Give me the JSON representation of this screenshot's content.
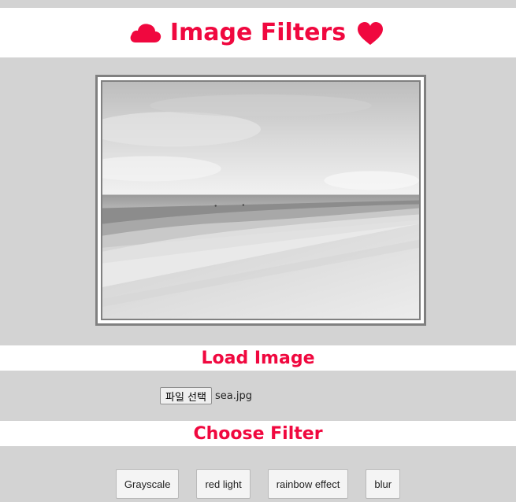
{
  "header": {
    "title": "Image Filters",
    "left_icon": "cloud-icon",
    "right_icon": "heart-icon",
    "accent_color": "#f0083f"
  },
  "preview": {
    "image_description_icon": "beach-photo"
  },
  "load_section": {
    "heading": "Load Image",
    "file_button_label": "파일 선택",
    "file_name": "sea.jpg"
  },
  "filter_section": {
    "heading": "Choose Filter",
    "buttons": [
      "Grayscale",
      "red light",
      "rainbow effect",
      "blur"
    ]
  }
}
